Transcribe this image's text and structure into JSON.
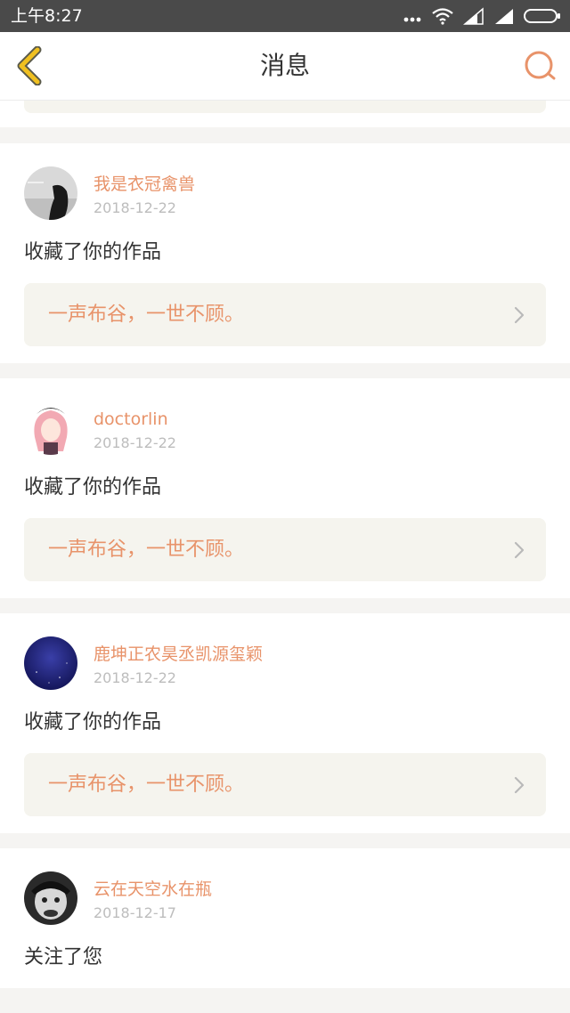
{
  "status_bar": {
    "time": "上午8:27"
  },
  "header": {
    "title": "消息",
    "back_icon": "chevron-left-icon",
    "search_icon": "search-icon"
  },
  "colors": {
    "accent": "#e8936a",
    "back_icon": "#f0c020",
    "work_box_bg": "#f5f4ee",
    "page_bg": "#f5f4f2"
  },
  "messages": [
    {
      "username": "我是衣冠禽兽",
      "date": "2018-12-22",
      "action": "收藏了你的作品",
      "work_title": "一声布谷，一世不顾。"
    },
    {
      "username": "doctorlin",
      "date": "2018-12-22",
      "action": "收藏了你的作品",
      "work_title": "一声布谷，一世不顾。"
    },
    {
      "username": "鹿坤正农昊丞凯源玺颖",
      "date": "2018-12-22",
      "action": "收藏了你的作品",
      "work_title": "一声布谷，一世不顾。"
    },
    {
      "username": "云在天空水在瓶",
      "date": "2018-12-17",
      "action": "关注了您"
    }
  ]
}
